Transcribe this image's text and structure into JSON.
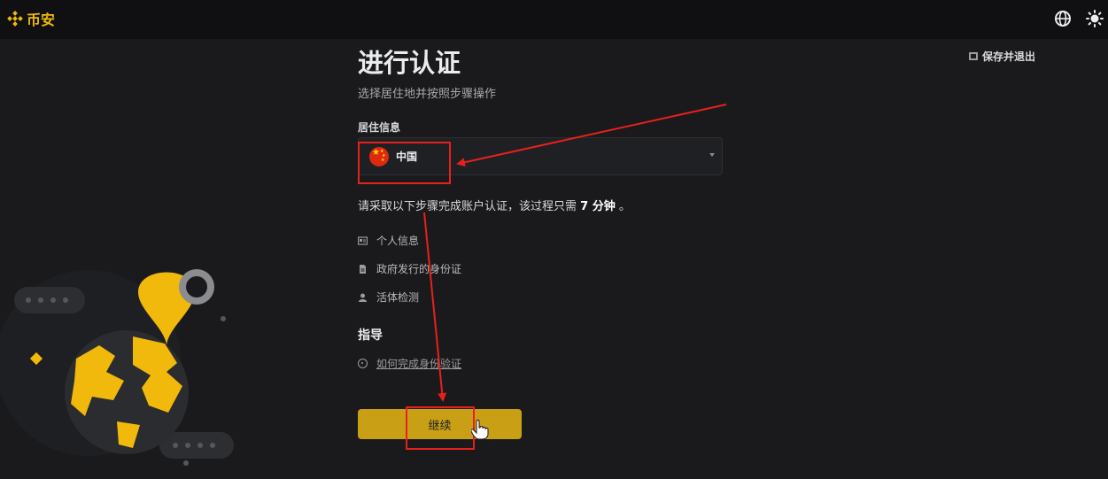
{
  "header": {
    "brand": "币安",
    "brand_color": "#f0b90b",
    "icons": [
      "globe-icon",
      "theme-icon"
    ]
  },
  "toolbar": {
    "save_exit_label": "保存并退出"
  },
  "page": {
    "title": "进行认证",
    "subtitle": "选择居住地并按照步骤操作"
  },
  "residence": {
    "label": "居住信息",
    "selected_country": "中国"
  },
  "notice": {
    "prefix": "请采取以下步骤完成账户认证，该过程只需 ",
    "minutes": "7 分钟",
    "suffix": " 。"
  },
  "steps": [
    {
      "label": "个人信息",
      "icon": "id-card-icon"
    },
    {
      "label": "政府发行的身份证",
      "icon": "document-icon"
    },
    {
      "label": "活体检测",
      "icon": "person-icon"
    }
  ],
  "guide": {
    "title": "指导",
    "link_label": "如何完成身份验证"
  },
  "continue_label": "继续",
  "colors": {
    "accent": "#f0b90b",
    "button": "#c99f16",
    "annotation": "#e8201c",
    "background": "#1a1a1c"
  }
}
